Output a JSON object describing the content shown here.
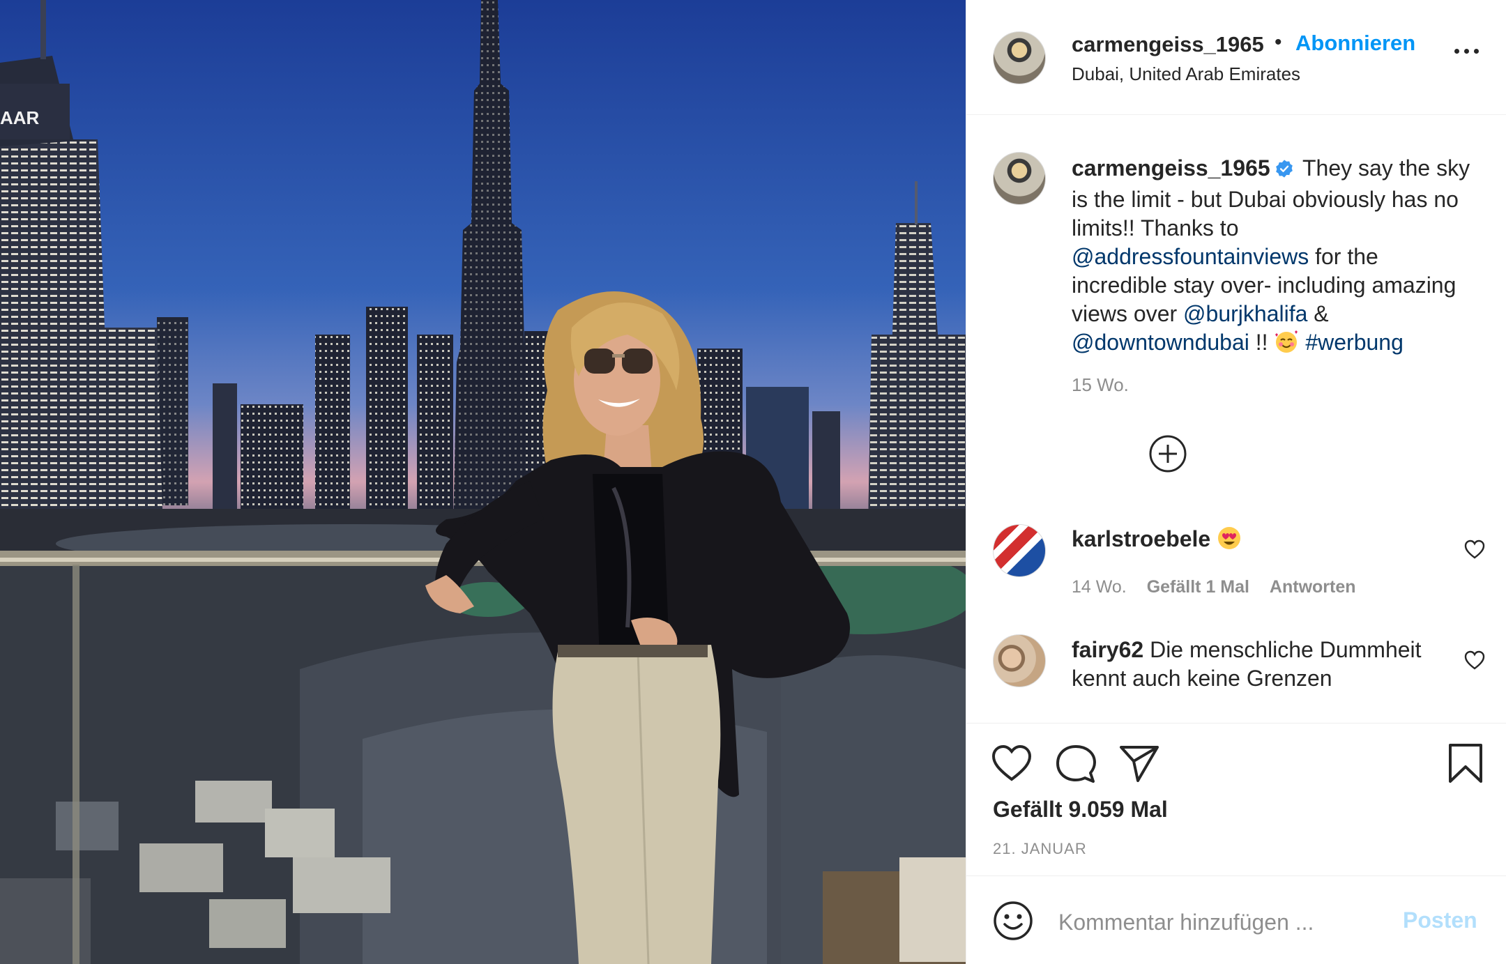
{
  "post": {
    "username": "carmengeiss_1965",
    "follow_label": "Abonnieren",
    "separator": "•",
    "location": "Dubai, United Arab Emirates"
  },
  "caption": {
    "username": "carmengeiss_1965",
    "text_1": "They say the sky is the limit - but Dubai obviously has no limits!! Thanks to",
    "mention_1": "@addressfountainviews",
    "text_2": "for the incredible stay over- including amazing views over",
    "mention_2": "@burjkhalifa",
    "text_3": "&",
    "mention_3": "@downtowndubai",
    "text_4": "!!",
    "hashtag": "#werbung",
    "time": "15 Wo."
  },
  "comments": [
    {
      "username": "karlstroebele",
      "text": "",
      "time": "14 Wo.",
      "likes": "Gefällt 1 Mal",
      "reply": "Antworten"
    },
    {
      "username": "fairy62",
      "text": "Die menschliche Dummheit kennt auch keine Grenzen"
    }
  ],
  "actions": {
    "likes_count": "Gefällt 9.059 Mal",
    "date": "21. JANUAR"
  },
  "composer": {
    "placeholder": "Kommentar hinzufügen ...",
    "post_label": "Posten"
  },
  "colors": {
    "link": "#00376b",
    "follow": "#0095f6",
    "post_disabled": "#b2dffc",
    "meta": "#8e8e8e"
  },
  "icons": [
    "verified-badge-icon",
    "more-options-icon",
    "load-more-plus-icon",
    "heart-icon",
    "comment-icon",
    "share-icon",
    "bookmark-icon",
    "emoji-icon",
    "heart-eyes-emoji",
    "smiling-hearts-emoji"
  ]
}
